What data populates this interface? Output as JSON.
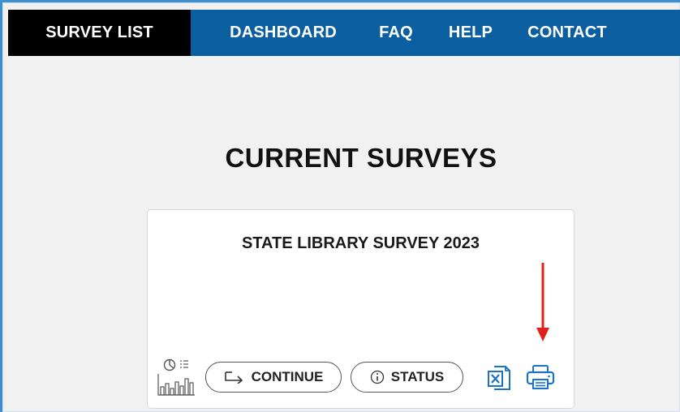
{
  "nav": {
    "items": [
      "SURVEY LIST",
      "DASHBOARD",
      "FAQ",
      "HELP",
      "CONTACT"
    ],
    "active": "SURVEY LIST"
  },
  "main": {
    "title": "CURRENT SURVEYS"
  },
  "survey_card": {
    "title": "STATE LIBRARY SURVEY 2023",
    "continue_label": "CONTINUE",
    "status_label": "STATUS",
    "icons": [
      "report-chart-icon",
      "arrow-right-icon",
      "info-icon",
      "excel-export-icon",
      "print-icon"
    ]
  },
  "annotation": {
    "arrow_color": "#e0211b"
  },
  "colors": {
    "nav_bg": "#0b5fa0",
    "nav_active_bg": "#000000",
    "icon_blue": "#1a73c8"
  }
}
